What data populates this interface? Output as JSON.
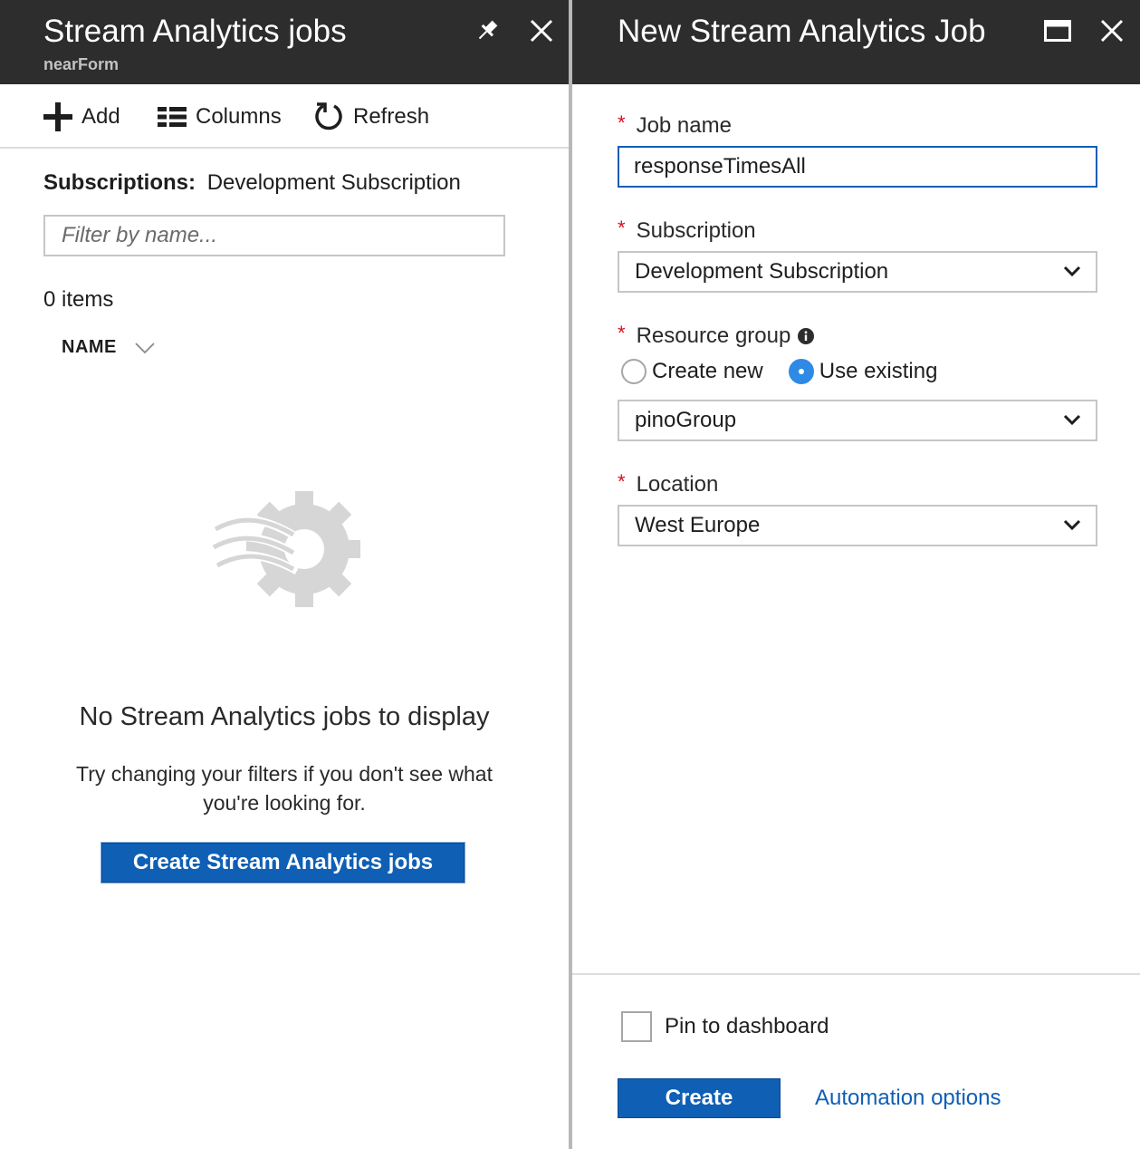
{
  "left_blade": {
    "title": "Stream Analytics jobs",
    "subtitle": "nearForm",
    "pin_icon": "pin-icon",
    "close_icon": "close-icon",
    "commands": [
      {
        "label": "Add",
        "icon": "plus-icon"
      },
      {
        "label": "Columns",
        "icon": "columns-icon"
      },
      {
        "label": "Refresh",
        "icon": "refresh-icon"
      }
    ],
    "subscriptions_label": "Subscriptions:",
    "subscriptions_value": "Development Subscription",
    "filter_placeholder": "Filter by name...",
    "item_count": "0 items",
    "column_header": "NAME",
    "empty_icon": "stream-analytics-gear-icon",
    "empty_title": "No Stream Analytics jobs to display",
    "empty_message": "Try changing your filters if you don't see what you're looking for.",
    "create_button": "Create Stream Analytics jobs"
  },
  "right_blade": {
    "title": "New Stream Analytics Job",
    "maximize_icon": "maximize-icon",
    "close_icon": "close-icon",
    "required_marker": "*",
    "job_name": {
      "label": "Job name",
      "value": "responseTimesAll"
    },
    "subscription": {
      "label": "Subscription",
      "value": "Development Subscription"
    },
    "resource_group": {
      "label": "Resource group",
      "info_icon": "info-icon",
      "options": [
        {
          "label": "Create new",
          "selected": false
        },
        {
          "label": "Use existing",
          "selected": true
        }
      ],
      "value": "pinoGroup"
    },
    "location": {
      "label": "Location",
      "value": "West Europe"
    },
    "pin_to_dashboard": {
      "label": "Pin to dashboard",
      "checked": false
    },
    "create_button": "Create",
    "automation_link": "Automation options"
  },
  "colors": {
    "header_bg": "#2d2d2d",
    "primary": "#0f5fb5",
    "required": "#e00b1c",
    "radio_selected": "#2f8ae5"
  }
}
